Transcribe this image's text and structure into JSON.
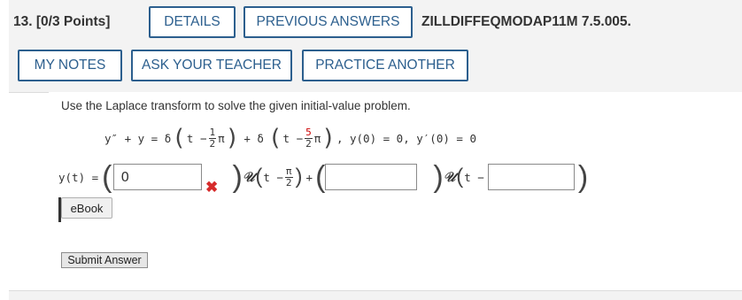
{
  "header": {
    "question_number": "13.",
    "points": "[0/3 Points]",
    "details_label": "DETAILS",
    "previous_answers_label": "PREVIOUS ANSWERS",
    "problem_code": "ZILLDIFFEQMODAP11M 7.5.005.",
    "my_notes_label": "MY NOTES",
    "ask_teacher_label": "ASK YOUR TEACHER",
    "practice_another_label": "PRACTICE ANOTHER"
  },
  "question": {
    "prompt": "Use the Laplace transform to solve the given initial-value problem.",
    "equation": {
      "lhs": "y″ + y = δ",
      "t1": "t −",
      "frac1_num": "1",
      "frac1_den": "2",
      "pi": "π",
      "plus": "+ δ",
      "t2": "t −",
      "frac2_num": "5",
      "frac2_den": "2",
      "initial_conditions": ",  y(0) = 0, y′(0) = 0"
    }
  },
  "answer": {
    "label": "y(t) =",
    "field1_value": "0",
    "field1_status": "incorrect",
    "unit_step_symbol": "𝒰",
    "t_minus": "t −",
    "frac_num": "π",
    "frac_den": "2",
    "plus": "+",
    "field2_value": "",
    "field3_value": "",
    "incorrect_color": "#d62b2b"
  },
  "ebook_label": "eBook",
  "submit_label": "Submit Answer",
  "colors": {
    "accent": "#2c5f8e",
    "header_bg": "#f3f3f3"
  }
}
